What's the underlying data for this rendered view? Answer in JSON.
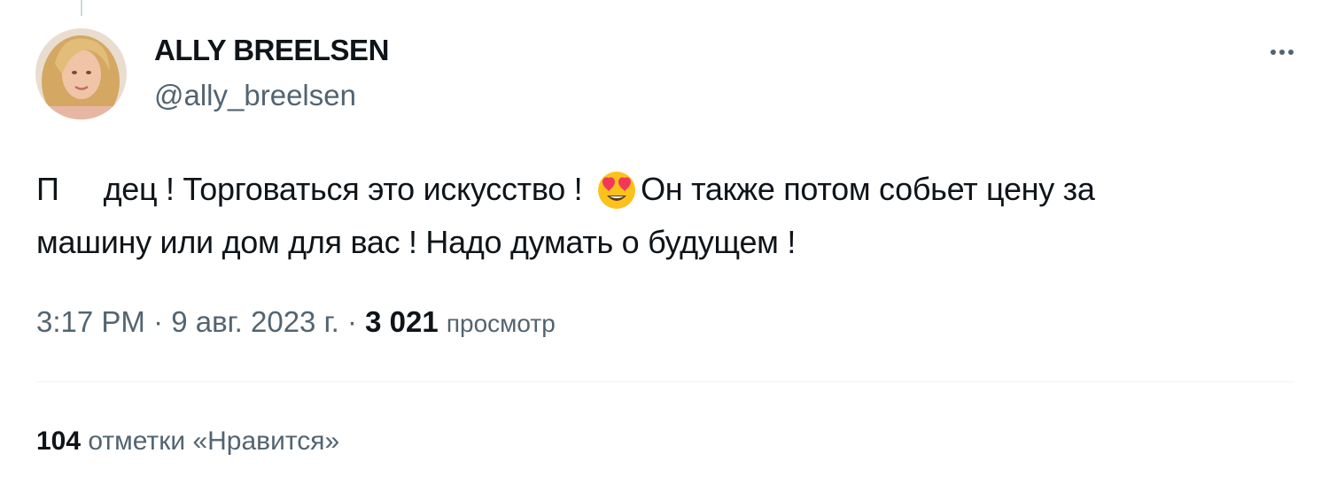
{
  "author": {
    "display_name": "ALLY BREELSEN",
    "handle": "@ally_breelsen"
  },
  "tweet": {
    "text_part1": "П",
    "text_part2": "дец ! Торговаться это искусство !",
    "emoji": "smiling-face-with-heart-eyes",
    "text_part3": "Он также потом собьет цену за",
    "text_line2": "машину или дом для вас ! Надо думать о будущем !"
  },
  "meta": {
    "time": "3:17 PM",
    "separator": "·",
    "date": "9 авг. 2023 г.",
    "views_count": "3 021",
    "views_label": "просмотр"
  },
  "stats": {
    "likes_count": "104",
    "likes_label": "отметки «Нравится»"
  },
  "icons": {
    "more": "more-horizontal-icon"
  },
  "colors": {
    "text_primary": "#0f1419",
    "text_secondary": "#536471",
    "divider": "#eff3f4"
  }
}
